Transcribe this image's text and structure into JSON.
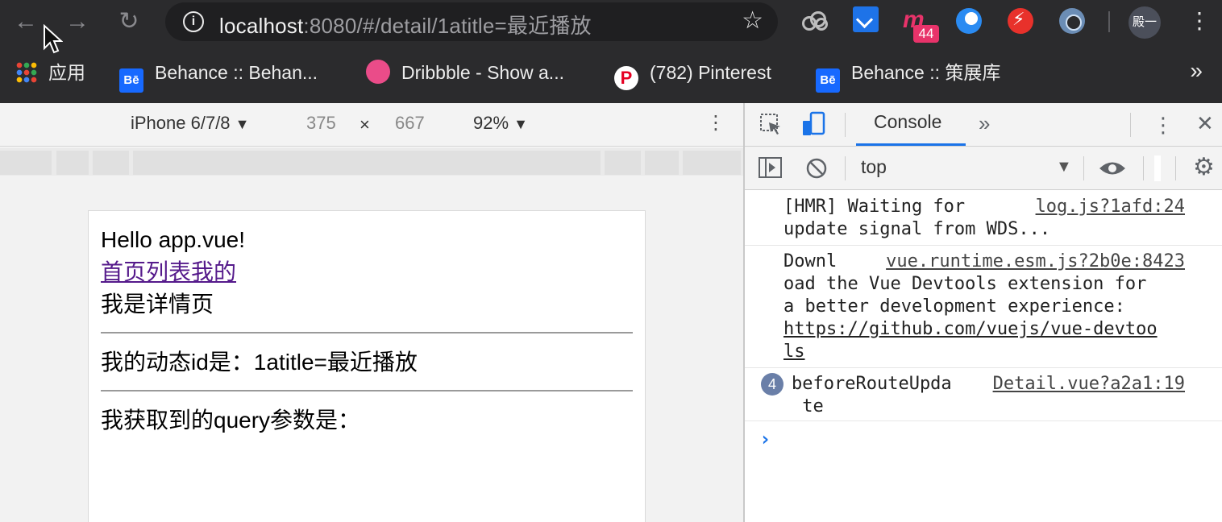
{
  "browser": {
    "url_host": "localhost",
    "url_rest": ":8080/#/detail/1atitle=最近播放",
    "extension_badge": "44",
    "avatar_text": "殿一",
    "bookmarks": [
      {
        "label": "应用",
        "icon": "apps-grid-icon"
      },
      {
        "label": "Behance :: Behan...",
        "icon": "behance-icon"
      },
      {
        "label": "Dribbble - Show a...",
        "icon": "dribbble-icon"
      },
      {
        "label": "(782) Pinterest",
        "icon": "pinterest-icon"
      },
      {
        "label": "Behance :: 策展库",
        "icon": "behance-icon"
      }
    ],
    "behance_glyph": "Bē",
    "pinterest_glyph": "P",
    "more_glyph": "»"
  },
  "device_toolbar": {
    "device": "iPhone 6/7/8",
    "width": "375",
    "times": "×",
    "height": "667",
    "zoom": "92%"
  },
  "page": {
    "line1": "Hello app.vue!",
    "nav_links": "首页列表我的",
    "line3": "我是详情页",
    "dynamic_id": "我的动态id是：1atitle=最近播放",
    "query": "我获取到的query参数是："
  },
  "devtools": {
    "tab": "Console",
    "context": "top",
    "messages": [
      {
        "text": "[HMR] Waiting for\nupdate signal from WDS...",
        "source": "log.js?1afd:24"
      },
      {
        "text": "Downl\noad the Vue Devtools extension for\na better development experience:",
        "source": "vue.runtime.esm.js?2b0e:8423",
        "link": "https://github.com/vuejs/vue-devtoo\nls"
      },
      {
        "text": "beforeRouteUpda\n te",
        "source": "Detail.vue?a2a1:19",
        "count": "4"
      }
    ]
  }
}
